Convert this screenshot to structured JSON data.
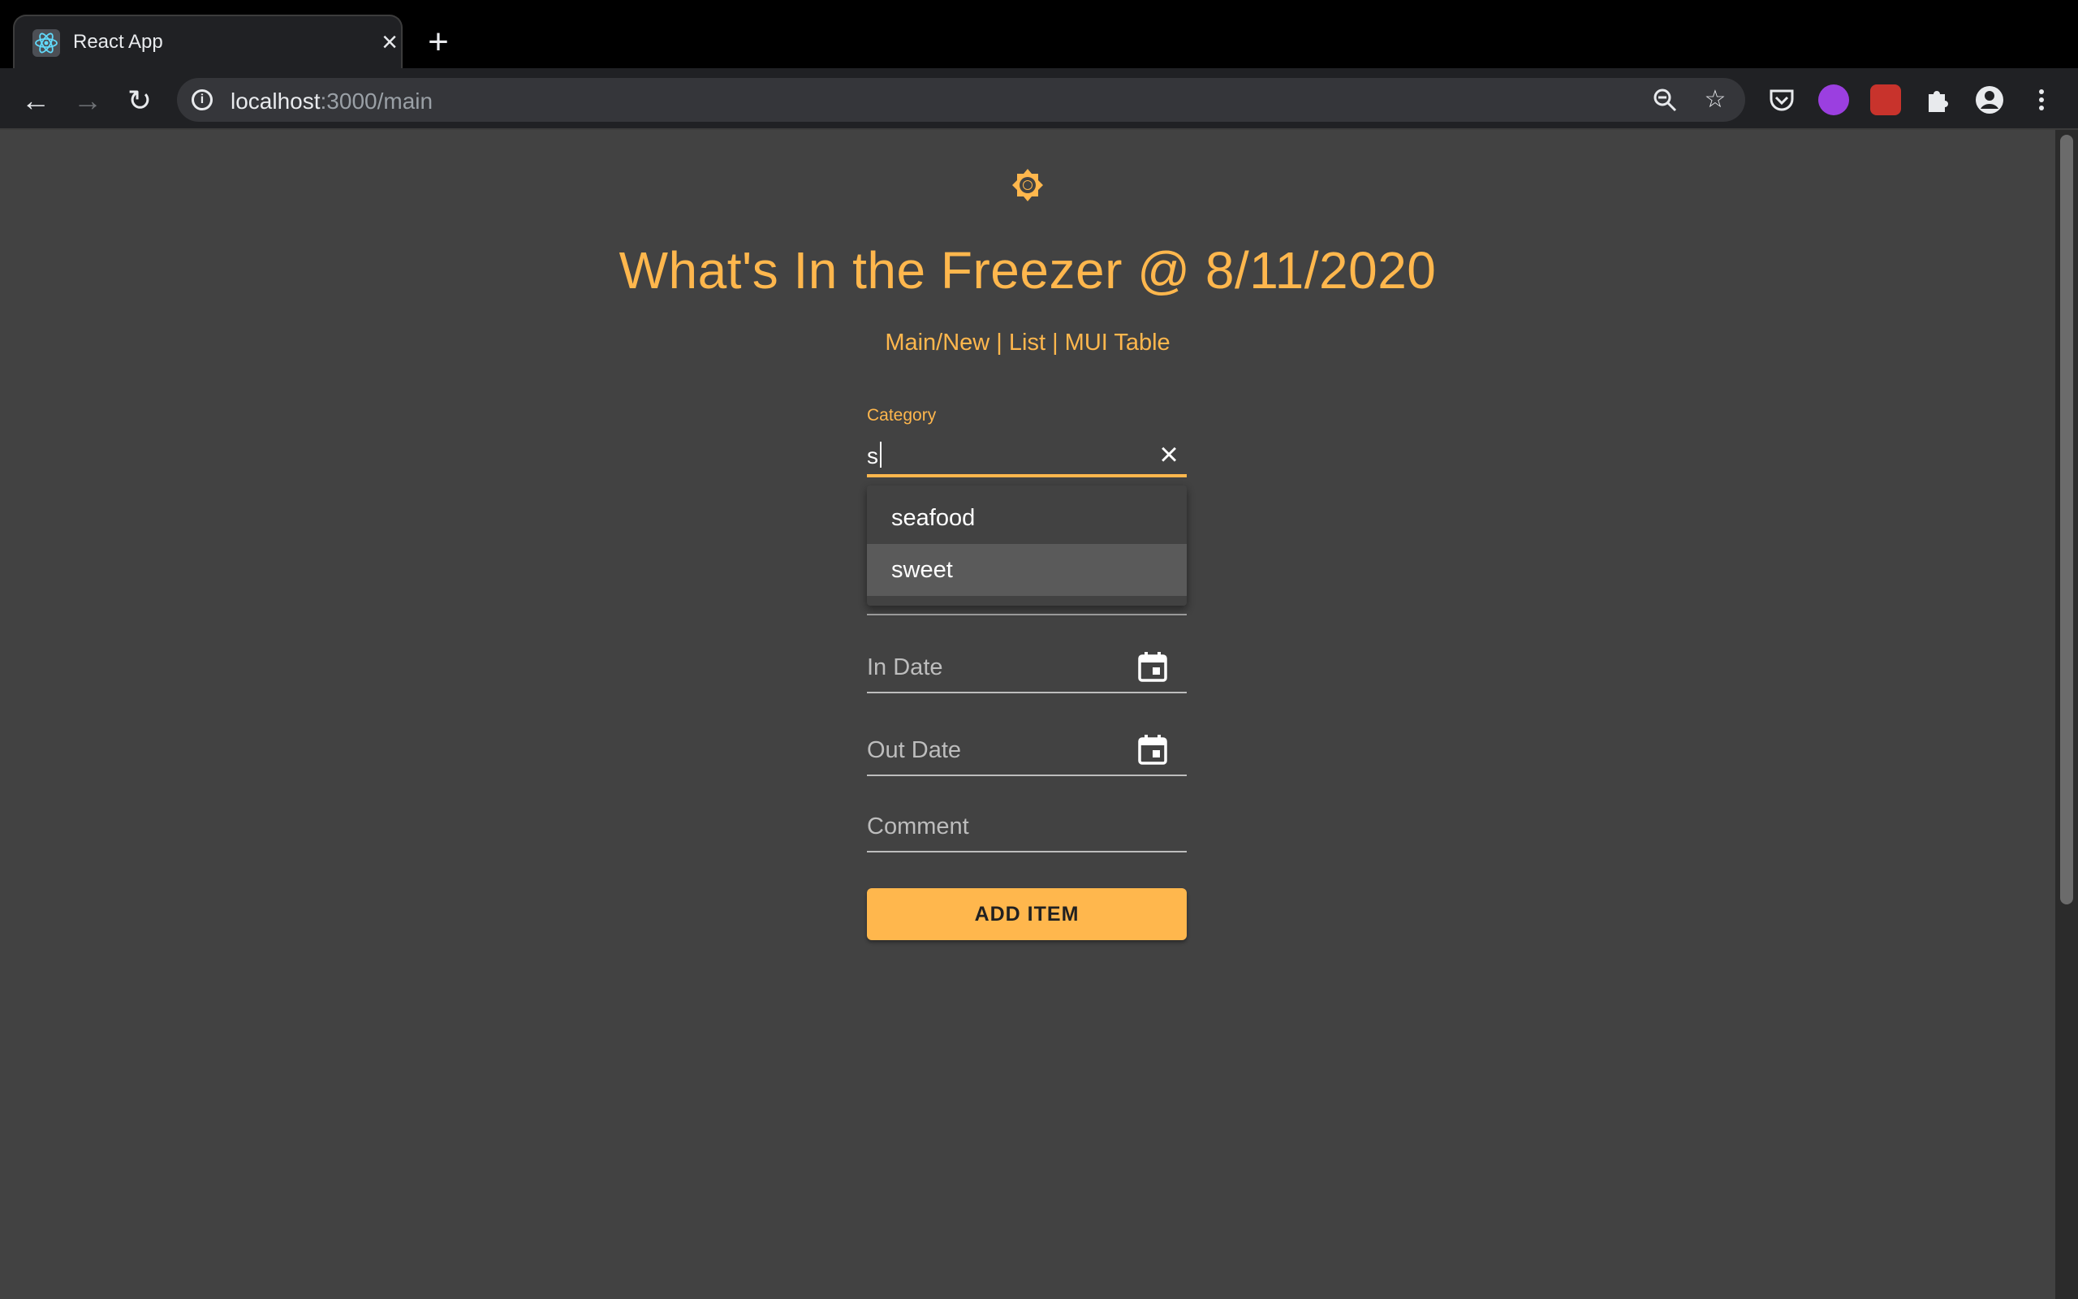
{
  "browser": {
    "tab_title": "React App",
    "url_host": "localhost",
    "url_rest": ":3000/main",
    "icons": [
      "react-favicon",
      "close-icon",
      "plus-icon",
      "back-icon",
      "forward-icon",
      "reload-icon",
      "info-icon",
      "zoom-icon",
      "star-icon",
      "pocket-icon",
      "extension-icon",
      "puzzle-icon",
      "account-icon",
      "menu-icon"
    ]
  },
  "page": {
    "theme_icon": "brightness-icon",
    "title": "What's In the Freezer @ 8/11/2020",
    "nav_links": "Main/New | List | MUI Table",
    "category": {
      "label": "Category",
      "value": "s",
      "options": [
        "seafood",
        "sweet"
      ],
      "highlighted": "sweet"
    },
    "fields": {
      "in_date": "In Date",
      "out_date": "Out Date",
      "comment": "Comment"
    },
    "add_button": "ADD ITEM"
  },
  "colors": {
    "accent": "#ffb74d",
    "page_bg": "#424242",
    "text": "#ffffff",
    "muted": "#bdbdbd"
  }
}
